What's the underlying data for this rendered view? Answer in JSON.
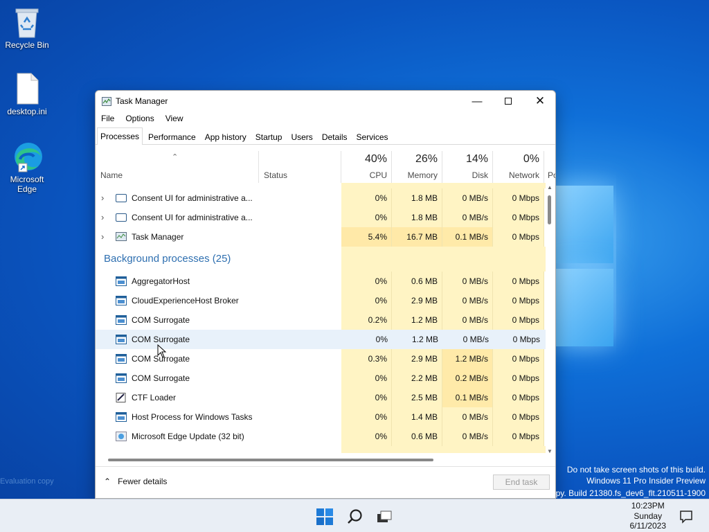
{
  "desktop": {
    "icons": [
      {
        "label": "Recycle Bin"
      },
      {
        "label": "desktop.ini"
      },
      {
        "label": "Microsoft Edge"
      }
    ],
    "watermark": {
      "line1": "Do not take screen shots of this build.",
      "line2": "Windows 11 Pro Insider Preview",
      "line3": "copy. Build 21380.fs_dev6_flt.210511-1900"
    },
    "left_faint_text": "Evaluation copy"
  },
  "window": {
    "title": "Task Manager",
    "menu": [
      "File",
      "Options",
      "View"
    ],
    "tabs": [
      "Processes",
      "Performance",
      "App history",
      "Startup",
      "Users",
      "Details",
      "Services"
    ],
    "active_tab": "Processes",
    "columns": {
      "name": "Name",
      "status": "Status",
      "cpu": {
        "pct": "40%",
        "label": "CPU"
      },
      "memory": {
        "pct": "26%",
        "label": "Memory"
      },
      "disk": {
        "pct": "14%",
        "label": "Disk"
      },
      "network": {
        "pct": "0%",
        "label": "Network"
      },
      "power_partial": "Po"
    },
    "app_rows": [
      {
        "name": "Consent UI for administrative a...",
        "cpu": "0%",
        "memory": "1.8 MB",
        "disk": "0 MB/s",
        "network": "0 Mbps"
      },
      {
        "name": "Consent UI for administrative a...",
        "cpu": "0%",
        "memory": "1.8 MB",
        "disk": "0 MB/s",
        "network": "0 Mbps"
      },
      {
        "name": "Task Manager",
        "cpu": "5.4%",
        "memory": "16.7 MB",
        "disk": "0.1 MB/s",
        "network": "0 Mbps"
      }
    ],
    "background_section": "Background processes (25)",
    "bg_rows": [
      {
        "name": "AggregatorHost",
        "cpu": "0%",
        "memory": "0.6 MB",
        "disk": "0 MB/s",
        "network": "0 Mbps"
      },
      {
        "name": "CloudExperienceHost Broker",
        "cpu": "0%",
        "memory": "2.9 MB",
        "disk": "0 MB/s",
        "network": "0 Mbps"
      },
      {
        "name": "COM Surrogate",
        "cpu": "0.2%",
        "memory": "1.2 MB",
        "disk": "0 MB/s",
        "network": "0 Mbps"
      },
      {
        "name": "COM Surrogate",
        "cpu": "0%",
        "memory": "1.2 MB",
        "disk": "0 MB/s",
        "network": "0 Mbps"
      },
      {
        "name": "COM Surrogate",
        "cpu": "0.3%",
        "memory": "2.9 MB",
        "disk": "1.2 MB/s",
        "network": "0 Mbps"
      },
      {
        "name": "COM Surrogate",
        "cpu": "0%",
        "memory": "2.2 MB",
        "disk": "0.2 MB/s",
        "network": "0 Mbps"
      },
      {
        "name": "CTF Loader",
        "cpu": "0%",
        "memory": "2.5 MB",
        "disk": "0.1 MB/s",
        "network": "0 Mbps"
      },
      {
        "name": "Host Process for Windows Tasks",
        "cpu": "0%",
        "memory": "1.4 MB",
        "disk": "0 MB/s",
        "network": "0 Mbps"
      },
      {
        "name": "Microsoft Edge Update (32 bit)",
        "cpu": "0%",
        "memory": "0.6 MB",
        "disk": "0 MB/s",
        "network": "0 Mbps"
      }
    ],
    "footer": {
      "fewer_details": "Fewer details",
      "end_task": "End task"
    }
  },
  "taskbar": {
    "time": "10:23PM",
    "day": "Sunday",
    "date": "6/11/2023"
  },
  "colors": {
    "accent": "#2e6fb0",
    "cpu_heat": "#fff4c4",
    "cpu_heat_high": "#ffe9a8"
  }
}
